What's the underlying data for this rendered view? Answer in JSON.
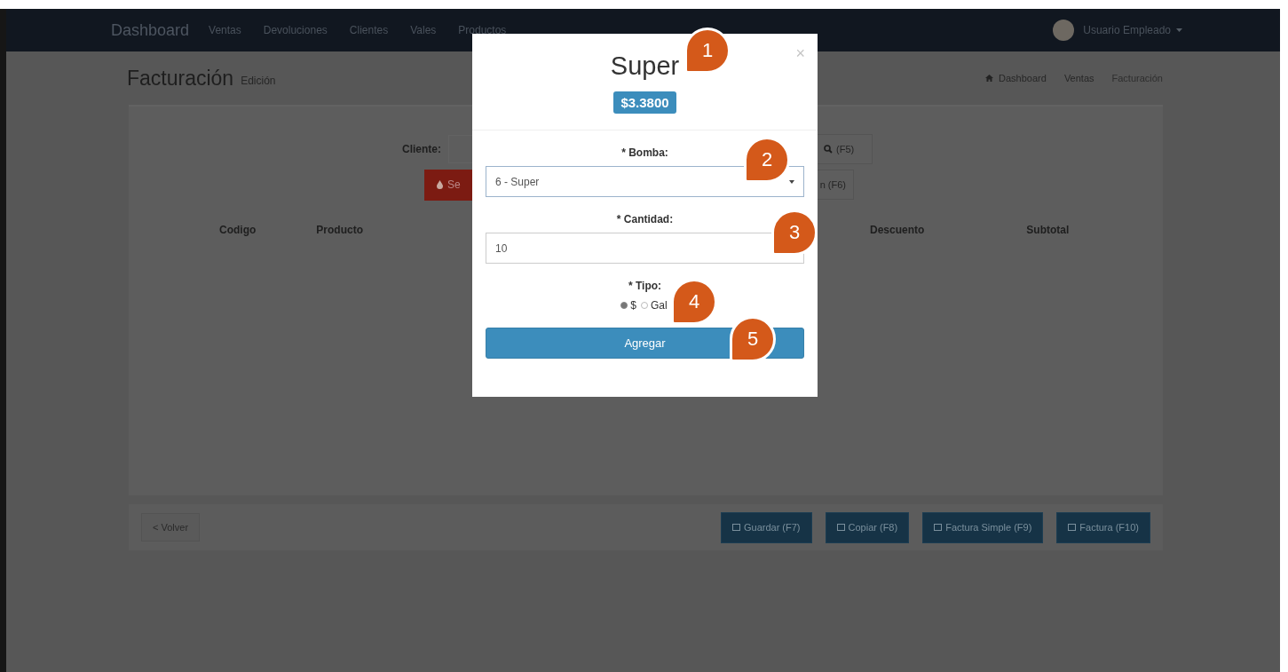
{
  "navbar": {
    "brand": "Dashboard",
    "links": [
      "Ventas",
      "Devoluciones",
      "Clientes",
      "Vales",
      "Productos"
    ],
    "user": "Usuario Empleado"
  },
  "page_header": {
    "title": "Facturación",
    "subtitle": "Edición"
  },
  "breadcrumb": [
    "Dashboard",
    "Ventas",
    "Facturación"
  ],
  "form": {
    "cliente_label": "Cliente:",
    "search_button": "(F5)",
    "red_button": "Se",
    "button_2": "n (F6)"
  },
  "table": {
    "columns": [
      "Codigo",
      "Producto",
      "Descuento",
      "Subtotal"
    ]
  },
  "footer": {
    "back_button": "< Volver",
    "buttons": [
      "Guardar (F7)",
      "Copiar (F8)",
      "Factura Simple (F9)",
      "Factura (F10)"
    ]
  },
  "modal": {
    "title": "Super",
    "price": "$3.3800",
    "close": "×",
    "bomba_label": "* Bomba:",
    "bomba_value": "6 - Super",
    "cantidad_label": "* Cantidad:",
    "cantidad_value": "10",
    "tipo_label": "* Tipo:",
    "tipo_options": [
      {
        "label": "$",
        "selected": true
      },
      {
        "label": "Gal",
        "selected": false
      }
    ],
    "submit": "Agregar"
  },
  "callouts": [
    "1",
    "2",
    "3",
    "4",
    "5"
  ]
}
